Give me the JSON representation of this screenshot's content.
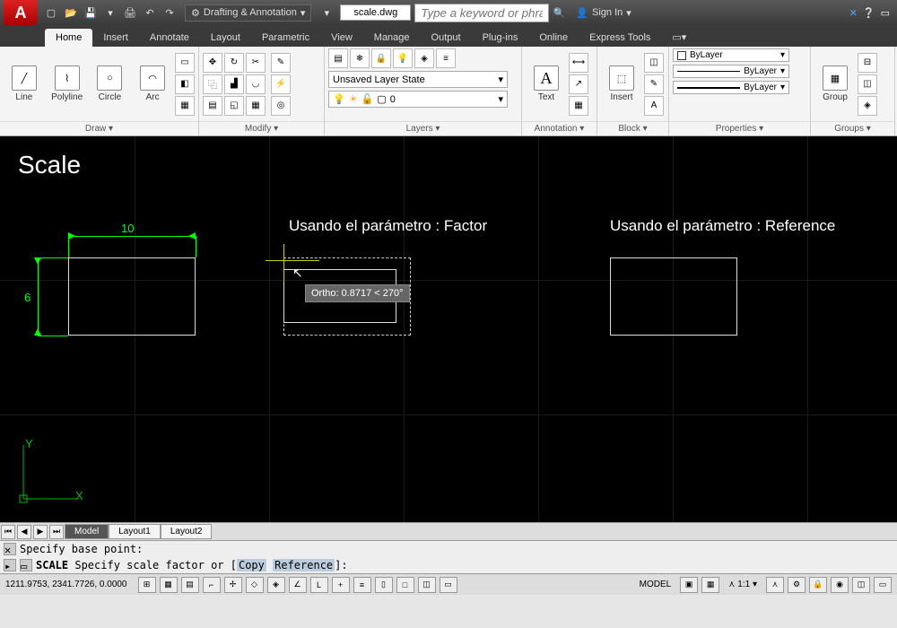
{
  "title": {
    "workspace": "Drafting & Annotation",
    "document": "scale.dwg",
    "search_placeholder": "Type a keyword or phrase",
    "signin": "Sign In"
  },
  "tabs": [
    "Home",
    "Insert",
    "Annotate",
    "Layout",
    "Parametric",
    "View",
    "Manage",
    "Output",
    "Plug-ins",
    "Online",
    "Express Tools"
  ],
  "active_tab": "Home",
  "ribbon": {
    "draw": {
      "label": "Draw",
      "tools": [
        "Line",
        "Polyline",
        "Circle",
        "Arc"
      ]
    },
    "modify": {
      "label": "Modify"
    },
    "layers": {
      "label": "Layers",
      "state": "Unsaved Layer State",
      "current": "0"
    },
    "annotation": {
      "label": "Annotation",
      "tool": "Text"
    },
    "block": {
      "label": "Block",
      "tool": "Insert"
    },
    "properties": {
      "label": "Properties",
      "color": "ByLayer",
      "ltype": "ByLayer",
      "lweight": "ByLayer"
    },
    "groups": {
      "label": "Groups",
      "tool": "Group"
    }
  },
  "canvas": {
    "title": "Scale",
    "label_factor": "Usando el parámetro : Factor",
    "label_reference": "Usando el parámetro : Reference",
    "dim_horizontal": "10",
    "dim_vertical": "6",
    "tooltip": "Ortho: 0.8717 < 270°",
    "ucs_x": "X",
    "ucs_y": "Y"
  },
  "layout_tabs": [
    "Model",
    "Layout1",
    "Layout2"
  ],
  "command": {
    "line1": "Specify base point:",
    "prefix": "SCALE",
    "line2": "Specify scale factor or [",
    "opt1": "Copy",
    "opt2": "Reference",
    "line2_end": "]:"
  },
  "status": {
    "coords": "1211.9753, 2341.7726, 0.0000",
    "model": "MODEL",
    "scale": "1:1"
  }
}
